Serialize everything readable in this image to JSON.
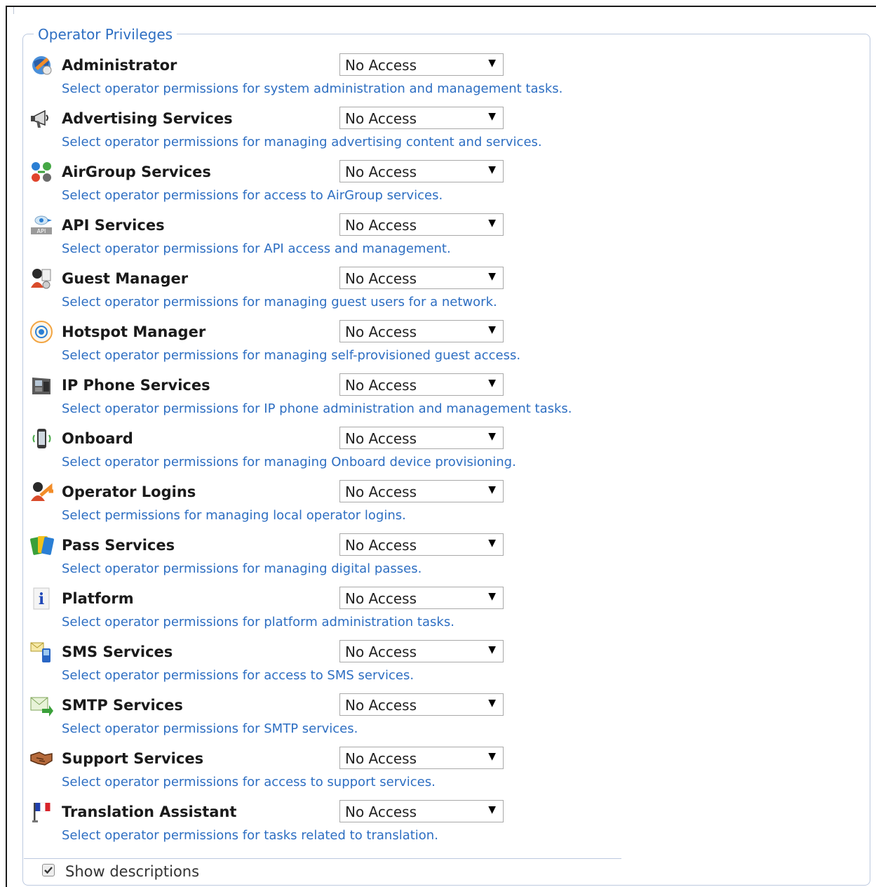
{
  "fieldset": {
    "legend": "Operator Privileges"
  },
  "privileges": [
    {
      "title": "Administrator",
      "description": "Select operator permissions for system administration and management tasks.",
      "value": "No Access",
      "icon": "administrator-icon"
    },
    {
      "title": "Advertising Services",
      "description": "Select operator permissions for managing advertising content and services.",
      "value": "No Access",
      "icon": "megaphone-icon"
    },
    {
      "title": "AirGroup Services",
      "description": "Select operator permissions for access to AirGroup services.",
      "value": "No Access",
      "icon": "airgroup-icon"
    },
    {
      "title": "API Services",
      "description": "Select operator permissions for API access and management.",
      "value": "No Access",
      "icon": "api-icon"
    },
    {
      "title": "Guest Manager",
      "description": "Select operator permissions for managing guest users for a network.",
      "value": "No Access",
      "icon": "guest-manager-icon"
    },
    {
      "title": "Hotspot Manager",
      "description": "Select operator permissions for managing self-provisioned guest access.",
      "value": "No Access",
      "icon": "hotspot-icon"
    },
    {
      "title": "IP Phone Services",
      "description": "Select operator permissions for IP phone administration and management tasks.",
      "value": "No Access",
      "icon": "ip-phone-icon"
    },
    {
      "title": "Onboard",
      "description": "Select operator permissions for managing Onboard device provisioning.",
      "value": "No Access",
      "icon": "onboard-device-icon"
    },
    {
      "title": "Operator Logins",
      "description": "Select permissions for managing local operator logins.",
      "value": "No Access",
      "icon": "operator-logins-icon"
    },
    {
      "title": "Pass Services",
      "description": "Select operator permissions for managing digital passes.",
      "value": "No Access",
      "icon": "passes-icon"
    },
    {
      "title": "Platform",
      "description": "Select operator permissions for platform administration tasks.",
      "value": "No Access",
      "icon": "info-icon"
    },
    {
      "title": "SMS Services",
      "description": "Select operator permissions for access to SMS services.",
      "value": "No Access",
      "icon": "sms-icon"
    },
    {
      "title": "SMTP Services",
      "description": "Select operator permissions for SMTP services.",
      "value": "No Access",
      "icon": "smtp-mail-icon"
    },
    {
      "title": "Support Services",
      "description": "Select operator permissions for access to support services.",
      "value": "No Access",
      "icon": "handshake-icon"
    },
    {
      "title": "Translation Assistant",
      "description": "Select operator permissions for tasks related to translation.",
      "value": "No Access",
      "icon": "translation-flag-icon"
    }
  ],
  "footer": {
    "show_descriptions_label": "Show descriptions",
    "show_descriptions_checked": true
  },
  "colors": {
    "link_blue": "#2d6ec2",
    "border": "#bcc9df"
  }
}
